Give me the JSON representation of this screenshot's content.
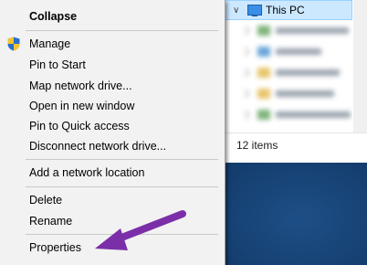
{
  "context_menu": {
    "items": [
      {
        "label": "Collapse",
        "bold": true
      },
      {
        "label": "Manage",
        "icon": "uac-shield-icon"
      },
      {
        "label": "Pin to Start"
      },
      {
        "label": "Map network drive..."
      },
      {
        "label": "Open in new window"
      },
      {
        "label": "Pin to Quick access"
      },
      {
        "label": "Disconnect network drive..."
      },
      {
        "label": "Add a network location"
      },
      {
        "label": "Delete"
      },
      {
        "label": "Rename"
      },
      {
        "label": "Properties"
      }
    ]
  },
  "explorer": {
    "nav_selected": "This PC",
    "status": "12 items"
  },
  "annotation": {
    "arrow_color": "#7a2fa8",
    "points_to": "Properties"
  }
}
